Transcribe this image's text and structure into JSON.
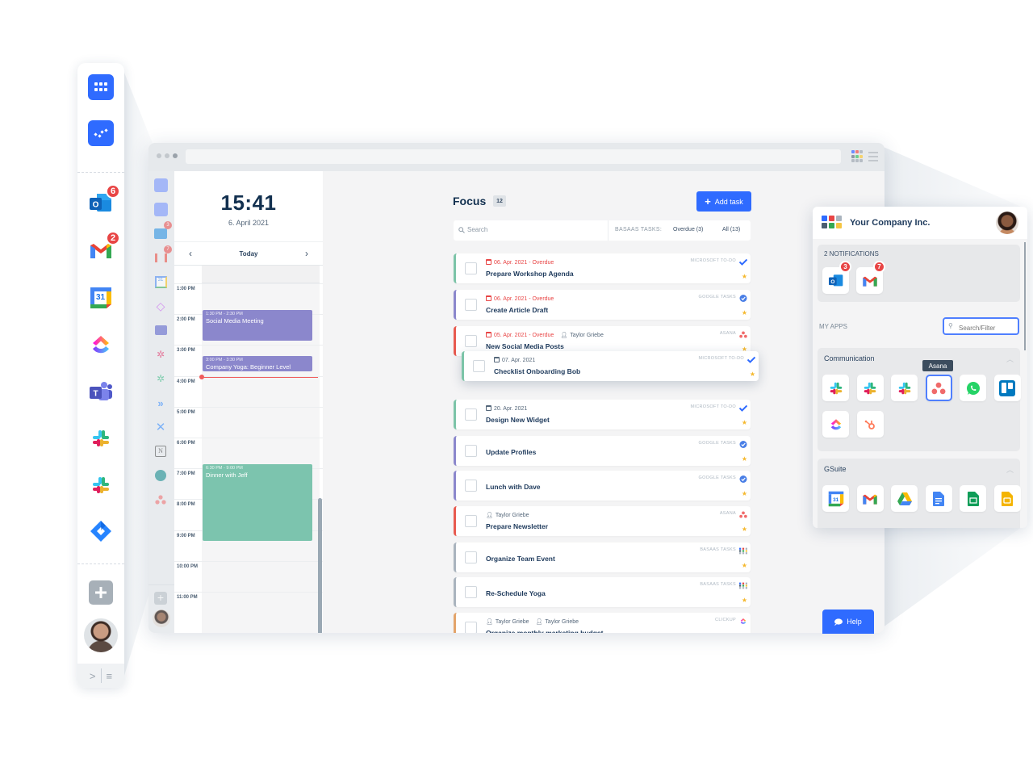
{
  "launcher": {
    "badges": {
      "outlook": "6",
      "gmail": "2"
    },
    "apps": [
      "outlook-icon",
      "gmail-icon",
      "google-calendar-icon",
      "clickup-icon",
      "teams-icon",
      "slack-icon",
      "slack-icon",
      "jira-icon"
    ],
    "calendar_day": "31",
    "footer": {
      "expand": ">",
      "menu": "≡"
    }
  },
  "browser": {
    "inner_sidebar": {
      "badges": {
        "outlook": "3",
        "gmail": "7"
      },
      "calendar_day": "31",
      "notion_letter": "N"
    },
    "calendar": {
      "time": "15:41",
      "date": "6. April 2021",
      "nav": {
        "prev": "‹",
        "today": "Today",
        "next": "›"
      },
      "hours": [
        "1:00 PM",
        "2:00 PM",
        "3:00 PM",
        "4:00 PM",
        "5:00 PM",
        "6:00 PM",
        "7:00 PM",
        "8:00 PM",
        "9:00 PM",
        "10:00 PM",
        "11:00 PM"
      ],
      "events": [
        {
          "time": "1:30 PM - 2:30 PM",
          "name": "Social Media Meeting",
          "color": "#8b87cc"
        },
        {
          "time": "3:00 PM - 3:30 PM",
          "name": "Company Yoga: Beginner Level",
          "color": "#8b87cc"
        },
        {
          "time": "6:30 PM - 9:00 PM",
          "name": "Dinner with Jeff",
          "color": "#7cc4ae"
        }
      ],
      "now_color": "#ef5b5b"
    },
    "focus": {
      "title": "Focus",
      "count": "12",
      "add_task": "Add task",
      "search_placeholder": "Search",
      "filter_label": "BASAAS TASKS:",
      "filter_overdue": "Overdue (3)",
      "filter_all": "All (13)",
      "tasks": [
        {
          "date": "06. Apr. 2021 - Overdue",
          "assignee": "",
          "name": "Prepare Workshop Agenda",
          "source": "MICROSOFT TO-DO",
          "color": "#7cc4a8",
          "overdue": true
        },
        {
          "date": "06. Apr. 2021 - Overdue",
          "assignee": "",
          "name": "Create Article Draft",
          "source": "GOOGLE TASKS",
          "color": "#8b87cc",
          "overdue": true
        },
        {
          "date": "05. Apr. 2021 - Overdue",
          "assignee": "Taylor Griebe",
          "name": "New Social Media Posts",
          "source": "ASANA",
          "color": "#e85a4f",
          "overdue": true
        },
        {
          "date": "07. Apr. 2021",
          "assignee": "",
          "name": "Checklist Onboarding Bob",
          "source": "MICROSOFT TO-DO",
          "color": "#7cc4a8",
          "overdue": false,
          "dragging": true
        },
        {
          "date": "20. Apr. 2021",
          "assignee": "",
          "name": "Design New Widget",
          "source": "MICROSOFT TO-DO",
          "color": "#7cc4a8",
          "overdue": false
        },
        {
          "date": "",
          "assignee": "",
          "name": "Update Profiles",
          "source": "GOOGLE TASKS",
          "color": "#8b87cc",
          "overdue": false
        },
        {
          "date": "",
          "assignee": "",
          "name": "Lunch with Dave",
          "source": "GOOGLE TASKS",
          "color": "#8b87cc",
          "overdue": false
        },
        {
          "date": "",
          "assignee": "Taylor Griebe",
          "name": "Prepare Newsletter",
          "source": "ASANA",
          "color": "#e85a4f",
          "overdue": false
        },
        {
          "date": "",
          "assignee": "",
          "name": "Organize Team Event",
          "source": "BASAAS TASKS",
          "color": "#aab4be",
          "overdue": false
        },
        {
          "date": "",
          "assignee": "",
          "name": "Re-Schedule Yoga",
          "source": "BASAAS TASKS",
          "color": "#aab4be",
          "overdue": false
        },
        {
          "date": "",
          "assignee": "Taylor Griebe",
          "assignee2": "Taylor Griebe",
          "name": "Organize monthly marketing budget",
          "source": "CLICKUP",
          "color": "#e3a46a",
          "overdue": false
        }
      ]
    }
  },
  "panel": {
    "company": "Your Company Inc.",
    "notifications_label": "2 NOTIFICATIONS",
    "notifications": [
      {
        "app": "outlook-icon",
        "count": "3"
      },
      {
        "app": "gmail-icon",
        "count": "7"
      }
    ],
    "my_apps_label": "MY APPS",
    "filter_placeholder": "Search/Filter",
    "groups": [
      {
        "title": "Communication",
        "apps": [
          "slack-icon",
          "slack-icon",
          "slack-icon",
          "asana-icon",
          "whatsapp-icon",
          "trello-icon",
          "clickup-icon",
          "hubspot-icon"
        ],
        "selected": "asana-icon"
      },
      {
        "title": "GSuite",
        "apps": [
          "google-calendar-icon",
          "gmail-icon",
          "google-drive-icon",
          "google-docs-icon",
          "google-sheets-icon",
          "google-slides-icon"
        ]
      }
    ],
    "tooltip": "Asana",
    "calendar_day": "31"
  },
  "help": "Help",
  "colors": {
    "primary": "#2f6bff",
    "danger": "#e84545",
    "text": "#1e3a5c"
  }
}
